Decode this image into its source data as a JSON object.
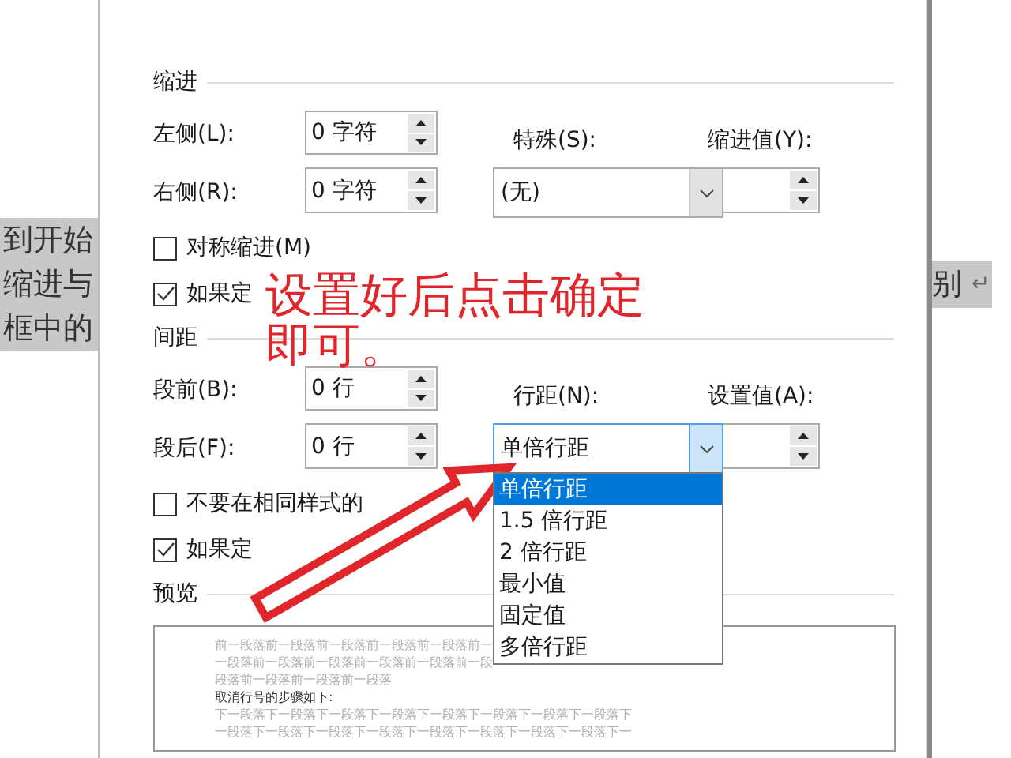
{
  "document": {
    "left_lines": [
      "到开始",
      "缩进与",
      "框中的"
    ],
    "right_lines": [
      {
        "text": "别",
        "mark": "↵"
      }
    ]
  },
  "indent": {
    "title": "缩进",
    "left": {
      "label": "左侧(L):",
      "value": "0 字符"
    },
    "right": {
      "label": "右侧(R):",
      "value": "0 字符"
    },
    "special": {
      "label": "特殊(S):",
      "value": "(无)"
    },
    "by": {
      "label": "缩进值(Y):"
    },
    "checks": [
      {
        "label": "对称缩进(M)",
        "checked": false
      },
      {
        "label": "如果定",
        "checked": true
      }
    ]
  },
  "spacing": {
    "title": "间距",
    "before": {
      "label": "段前(B):",
      "value": "0 行"
    },
    "after": {
      "label": "段后(F):",
      "value": "0 行"
    },
    "line_spacing": {
      "label": "行距(N):",
      "value": "单倍行距",
      "expanded": true,
      "options": [
        {
          "label": "单倍行距",
          "selected": true
        },
        {
          "label": "1.5 倍行距",
          "selected": false
        },
        {
          "label": "2 倍行距",
          "selected": false
        },
        {
          "label": "最小值",
          "selected": false
        },
        {
          "label": "固定值",
          "selected": false
        },
        {
          "label": "多倍行距",
          "selected": false
        }
      ]
    },
    "at": {
      "label": "设置值(A):"
    },
    "checks": [
      {
        "label": "不要在相同样式的",
        "checked": false
      },
      {
        "label": "如果定",
        "checked": true
      }
    ]
  },
  "preview": {
    "title": "预览",
    "lines": [
      {
        "kind": "context",
        "text": "前一段落前一段落前一段落前一段落前一段落前一"
      },
      {
        "kind": "context",
        "text": "一段落前一段落前一段落前一段落前一段落前一段"
      },
      {
        "kind": "context",
        "text": "段落前一段落前一段落前一段落"
      },
      {
        "kind": "sample",
        "text": "取消行号的步骤如下:"
      },
      {
        "kind": "context",
        "text": "下一段落下一段落下一段落下一段落下一段落下一段落下一段落下一段落下"
      },
      {
        "kind": "context",
        "text": "一段落下一段落下一段落下一段落下一段落下一段落下一段落下一段落下一"
      }
    ]
  },
  "annotation": {
    "lines": [
      "设置好后点击确定",
      "即可。"
    ]
  }
}
